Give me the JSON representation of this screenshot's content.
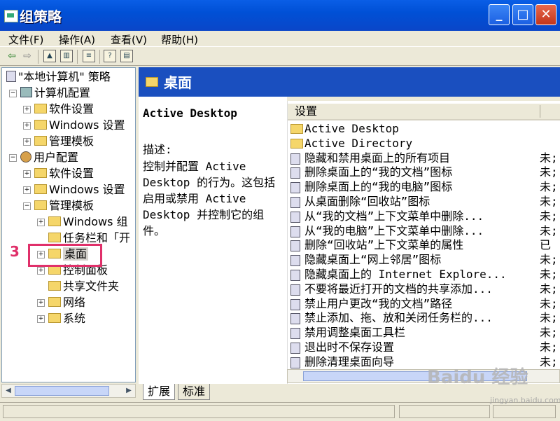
{
  "window": {
    "title": "组策略"
  },
  "menu": [
    "文件(F)",
    "操作(A)",
    "查看(V)",
    "帮助(H)"
  ],
  "toolbar": {
    "buttons": [
      "back-arrow-icon",
      "forward-arrow-icon",
      "up-folder-icon",
      "show-hide-tree-icon",
      "export-list-icon",
      "help-icon",
      "properties-icon"
    ]
  },
  "tree": {
    "root": "\"本地计算机\" 策略",
    "items": [
      "计算机配置",
      "软件设置",
      "Windows 设置",
      "管理模板",
      "用户配置",
      "软件设置",
      "Windows 设置",
      "管理模板",
      "Windows 组",
      "任务栏和「开",
      "桌面",
      "控制面板",
      "共享文件夹",
      "网络",
      "系统"
    ]
  },
  "annotation": {
    "step": "3"
  },
  "right": {
    "header_title": "桌面",
    "desc_title": "Active Desktop",
    "desc_label": "描述:",
    "desc_text": "控制并配置 Active Desktop 的行为。这包括启用或禁用 Active Desktop 并控制它的组件。"
  },
  "list": {
    "column_setting": "设置",
    "rows": [
      {
        "name": "Active Desktop",
        "state": "",
        "kind": "folder"
      },
      {
        "name": "Active Directory",
        "state": "",
        "kind": "folder"
      },
      {
        "name": "隐藏和禁用桌面上的所有项目",
        "state": "未;",
        "kind": "policy"
      },
      {
        "name": "删除桌面上的“我的文档”图标",
        "state": "未;",
        "kind": "policy"
      },
      {
        "name": "删除桌面上的“我的电脑”图标",
        "state": "未;",
        "kind": "policy"
      },
      {
        "name": "从桌面删除“回收站”图标",
        "state": "未;",
        "kind": "policy"
      },
      {
        "name": "从“我的文档”上下文菜单中删除...",
        "state": "未;",
        "kind": "policy"
      },
      {
        "name": "从“我的电脑”上下文菜单中删除...",
        "state": "未;",
        "kind": "policy"
      },
      {
        "name": "删除“回收站”上下文菜单的属性",
        "state": "已",
        "kind": "policy"
      },
      {
        "name": "隐藏桌面上“网上邻居”图标",
        "state": "未;",
        "kind": "policy"
      },
      {
        "name": "隐藏桌面上的 Internet Explore...",
        "state": "未;",
        "kind": "policy"
      },
      {
        "name": "不要将最近打开的文档的共享添加...",
        "state": "未;",
        "kind": "policy"
      },
      {
        "name": "禁止用户更改“我的文档”路径",
        "state": "未;",
        "kind": "policy"
      },
      {
        "name": "禁止添加、拖、放和关闭任务栏的...",
        "state": "未;",
        "kind": "policy"
      },
      {
        "name": "禁用调整桌面工具栏",
        "state": "未;",
        "kind": "policy"
      },
      {
        "name": "退出时不保存设置",
        "state": "未;",
        "kind": "policy"
      },
      {
        "name": "删除清理桌面向导",
        "state": "未;",
        "kind": "policy"
      }
    ]
  },
  "tabs": [
    "扩展",
    "标准"
  ],
  "watermark": {
    "brand": "Baidu 经验",
    "url": "jingyan.baidu.com"
  }
}
